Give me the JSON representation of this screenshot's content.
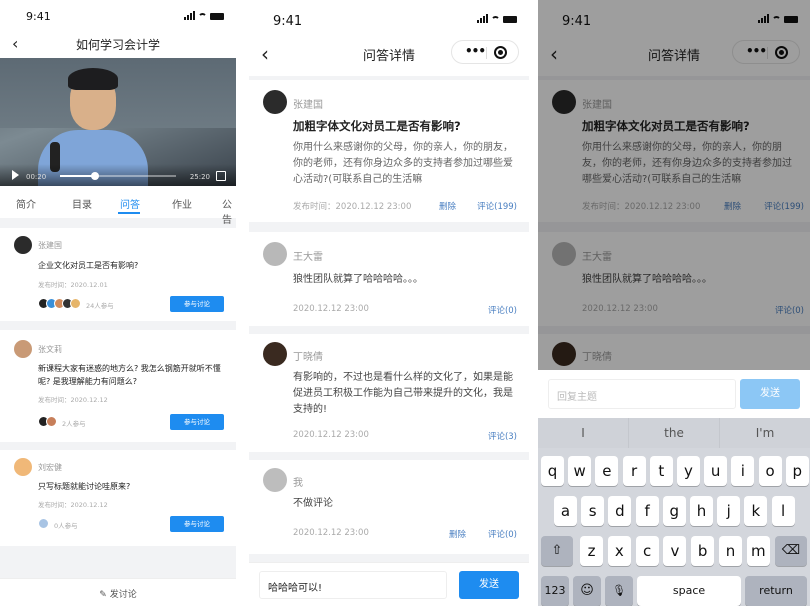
{
  "panel1": {
    "status_time": "9:41",
    "nav_title": "如何学习会计学",
    "video": {
      "time_current": "00:20",
      "time_total": "25:20",
      "progress": 0.3
    },
    "tabs": [
      "简介",
      "目录",
      "问答",
      "作业",
      "公告"
    ],
    "active_tab": "问答",
    "questions": [
      {
        "name": "张建国",
        "title": "企业文化对员工是否有影响?",
        "time": "发布时间：2020.12.01",
        "joined": "24人参与",
        "button": "参与讨论"
      },
      {
        "name": "张文莉",
        "title": "新课程大家有迷惑的地方么? 我怎么钢筋开就听不懂呢? 是我理解能力有问题么?",
        "time": "发布时间：2020.12.12",
        "joined": "2人参与",
        "button": "参与讨论"
      },
      {
        "name": "刘宏健",
        "title": "只写标题就能讨论哇原来?",
        "time": "发布时间：2020.12.12",
        "joined": "0人参与",
        "button": "参与讨论"
      }
    ],
    "compose_label": "发讨论"
  },
  "panel2": {
    "status_time": "9:41",
    "nav_title": "问答详情",
    "question": {
      "name": "张建国",
      "title": "加粗字体文化对员工是否有影响?",
      "body": "你用什么来感谢你的父母，你的亲人，你的朋友，你的老师，还有你身边众多的支持者参加过哪些爱心活动?(可联系自己的生活嘛",
      "time": "发布时间：2020.12.12 23:00",
      "delete": "删除",
      "comments": "评论(199)"
    },
    "answers": [
      {
        "name": "王大雷",
        "text": "狼性团队就算了哈哈哈哈。。。",
        "time": "2020.12.12 23:00",
        "comments": "评论(0)"
      },
      {
        "name": "丁晓倩",
        "text": "有影响的，不过也是看什么样的文化了，如果是能促进员工积极工作能为自己带来提升的文化，我是支持的!",
        "time": "2020.12.12 23:00",
        "comments": "评论(3)"
      },
      {
        "name": "我",
        "text": "不做评论",
        "time": "2020.12.12 23:00",
        "delete": "删除",
        "comments": "评论(0)"
      }
    ],
    "input_value": "哈哈哈可以!",
    "send": "发送"
  },
  "panel3": {
    "status_time": "9:41",
    "nav_title": "问答详情",
    "question": {
      "name": "张建国",
      "title": "加粗字体文化对员工是否有影响?",
      "body": "你用什么来感谢你的父母，你的亲人，你的朋友，你的老师，还有你身边众多的支持者参加过哪些爱心活动?(可联系自己的生活嘛",
      "time": "发布时间：2020.12.12 23:00",
      "delete": "删除",
      "comments": "评论(199)"
    },
    "answer1": {
      "name": "王大雷",
      "text": "狼性团队就算了哈哈哈哈。。。",
      "time": "2020.12.12 23:00",
      "comments": "评论(0)"
    },
    "answer2_name": "丁晓倩",
    "reply_placeholder": "回复主题",
    "send": "发送",
    "suggestions": [
      "I",
      "the",
      "I'm"
    ],
    "keys_row1": [
      "q",
      "w",
      "e",
      "r",
      "t",
      "y",
      "u",
      "i",
      "o",
      "p"
    ],
    "keys_row2": [
      "a",
      "s",
      "d",
      "f",
      "g",
      "h",
      "j",
      "k",
      "l"
    ],
    "keys_row3": [
      "z",
      "x",
      "c",
      "v",
      "b",
      "n",
      "m"
    ],
    "key_shift": "⇧",
    "key_delete": "⌫",
    "key_123": "123",
    "key_emoji": "☺",
    "key_mic": "🎙",
    "key_space": "space",
    "key_return": "return"
  },
  "colors": {
    "accent": "#1e8cf0",
    "accent_disabled": "#8cc7f5",
    "link": "#4a7fc1"
  }
}
